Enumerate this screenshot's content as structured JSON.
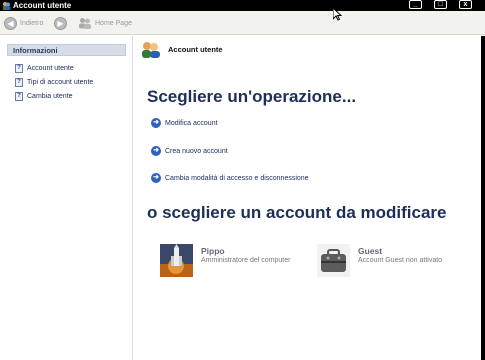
{
  "window": {
    "title": "Account utente"
  },
  "titlebar": {
    "minimize": "_",
    "maximize": "□",
    "close": "x"
  },
  "toolbar": {
    "back_label": "Indietro",
    "home_label": "Home Page"
  },
  "sidebar": {
    "panel_title": "Informazioni",
    "items": [
      {
        "label": "Account utente"
      },
      {
        "label": "Tipi di account utente"
      },
      {
        "label": "Cambia utente"
      }
    ]
  },
  "main": {
    "header_title": "Account utente",
    "heading_tasks": "Scegliere un'operazione...",
    "tasks": [
      {
        "label": "Modifica account"
      },
      {
        "label": "Crea nuovo account"
      },
      {
        "label": "Cambia modalità di accesso e disconnessione"
      }
    ],
    "heading_accounts": "o scegliere un account da modificare",
    "accounts": [
      {
        "name": "Pippo",
        "desc": "Amministratore del computer"
      },
      {
        "name": "Guest",
        "desc": "Account Guest non attivato"
      }
    ]
  }
}
